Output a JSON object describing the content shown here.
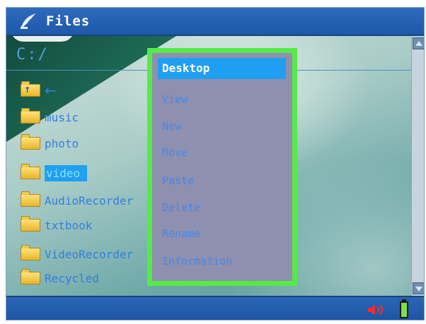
{
  "window": {
    "title": "Files"
  },
  "path": {
    "label": "C:/"
  },
  "file_list": {
    "items": [
      {
        "name": "",
        "type": "parent",
        "icon": "folder-up-icon"
      },
      {
        "name": "music",
        "type": "folder",
        "icon": "folder-icon"
      },
      {
        "name": "photo",
        "type": "folder",
        "icon": "folder-icon"
      },
      {
        "name": "video",
        "type": "folder",
        "icon": "folder-icon",
        "selected": true
      },
      {
        "name": "AudioRecorder",
        "type": "folder",
        "icon": "folder-icon"
      },
      {
        "name": "txtbook",
        "type": "folder",
        "icon": "folder-icon"
      },
      {
        "name": "VideoRecorder",
        "type": "folder",
        "icon": "folder-icon"
      },
      {
        "name": "Recycled",
        "type": "folder",
        "icon": "folder-icon"
      }
    ],
    "back_arrow": "←"
  },
  "context_menu": {
    "header": "Desktop",
    "items": [
      "View",
      "New",
      "Move",
      "Paste",
      "Delete",
      "Rename",
      "Information"
    ]
  },
  "status": {
    "speaker_icon": "speaker-muted-icon",
    "battery_icon": "battery-icon"
  },
  "colors": {
    "menu_border": "#56ea46",
    "menu_background": "#8f8faf",
    "highlight": "#1f9ff2",
    "title_bar": "#1e59aa"
  }
}
